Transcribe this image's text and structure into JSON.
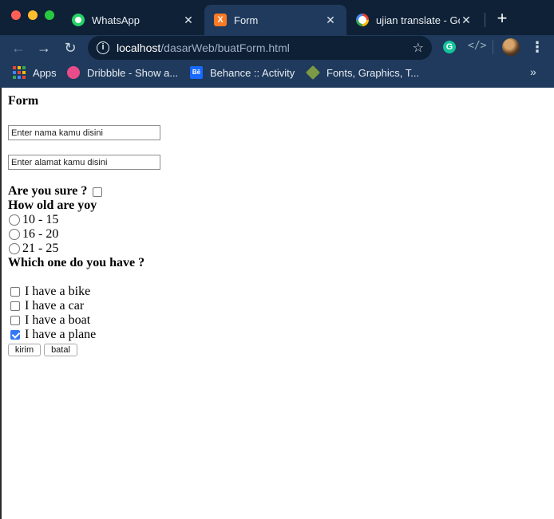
{
  "browser": {
    "tabs": [
      {
        "label": "WhatsApp",
        "icon": "whatsapp-icon",
        "active": false
      },
      {
        "label": "Form",
        "icon": "xampp-icon",
        "active": true
      },
      {
        "label": "ujian translate - Goo",
        "icon": "google-icon",
        "active": false
      }
    ],
    "url_host": "localhost",
    "url_path": "/dasarWeb/buatForm.html",
    "bookmarks": [
      {
        "label": "Apps",
        "icon": "apps-grid-icon"
      },
      {
        "label": "Dribbble - Show a...",
        "icon": "dribbble-icon"
      },
      {
        "label": "Behance :: Activity",
        "icon": "behance-icon"
      },
      {
        "label": "Fonts, Graphics, T...",
        "icon": "tag-icon"
      }
    ],
    "behance_glyph": "Bē",
    "more_glyph": "»"
  },
  "form": {
    "heading": "Form",
    "name_placeholder": "Enter nama kamu disini",
    "address_placeholder": "Enter alamat kamu disini",
    "sure_label": "Are you sure ?",
    "sure_checked": false,
    "age_label": "How old are yoy",
    "age_options": [
      "10 - 15",
      "16 - 20",
      "21 - 25"
    ],
    "have_label": "Which one do you have ?",
    "have_options": [
      {
        "label": "I have a bike",
        "checked": false
      },
      {
        "label": "I have a car",
        "checked": false
      },
      {
        "label": "I have a boat",
        "checked": false
      },
      {
        "label": "I have a plane",
        "checked": true
      }
    ],
    "submit_label": "kirim",
    "reset_label": "batal"
  }
}
